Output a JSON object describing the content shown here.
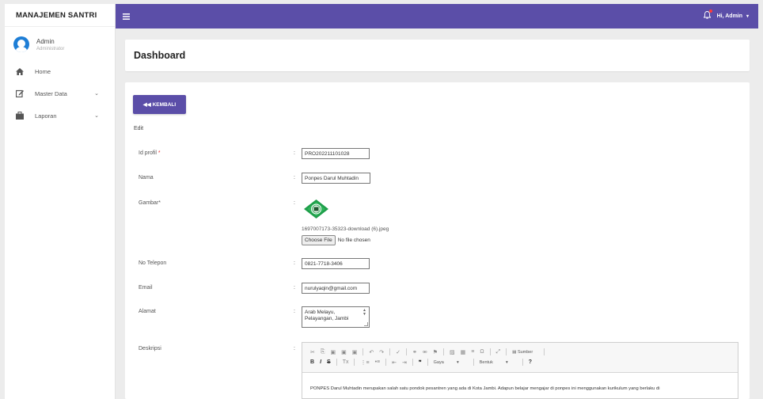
{
  "sidebar": {
    "brand": "MANAJEMEN SANTRI",
    "user_name": "Admin",
    "user_role": "Administrator",
    "items": [
      {
        "label": "Home",
        "icon": "home-icon"
      },
      {
        "label": "Master Data",
        "icon": "edit-icon",
        "chevron": "⌄"
      },
      {
        "label": "Laporan",
        "icon": "briefcase-icon",
        "chevron": "⌄"
      }
    ]
  },
  "topbar": {
    "greeting": "Hi, Admin",
    "caret": "▾"
  },
  "header": {
    "title": "Dashboard"
  },
  "content": {
    "back_label": "◀◀ KEMBALI",
    "section_label": "Edit",
    "fields": {
      "id_label": "Id profil",
      "id_required": "*",
      "id_value": "PRO202211101028",
      "nama_label": "Nama",
      "nama_value": "Ponpes Darul Muhtadin",
      "gambar_label": "Gambar*",
      "gambar_filename": "1697007173-35323-download (6).jpeg",
      "choose_file": "Choose File",
      "no_file": "No file chosen",
      "telepon_label": "No Telepon",
      "telepon_value": "0821-7718-3406",
      "email_label": "Email",
      "email_value": "nurulyaqin@gmail.com",
      "alamat_label": "Alamat",
      "alamat_line1": "Arab Melayu,",
      "alamat_line2": "Pelayangan, Jambi",
      "deskripsi_label": "Deskripsi",
      "colon": ":"
    },
    "editor": {
      "sumber": "Sumber",
      "gaya": "Gaya",
      "bentuk": "Bentuk",
      "help": "?",
      "body_text": "PONPES Darul Muhtadin merupakan salah satu pondok pesantren yang ada di Kota Jambi. Adapun belajar mengajar di ponpes ini menggunakan kurikulum yang berlaku di"
    }
  },
  "colors": {
    "primary": "#5b4ea8",
    "background": "#ececec",
    "notification_dot": "#ff3b3b"
  }
}
